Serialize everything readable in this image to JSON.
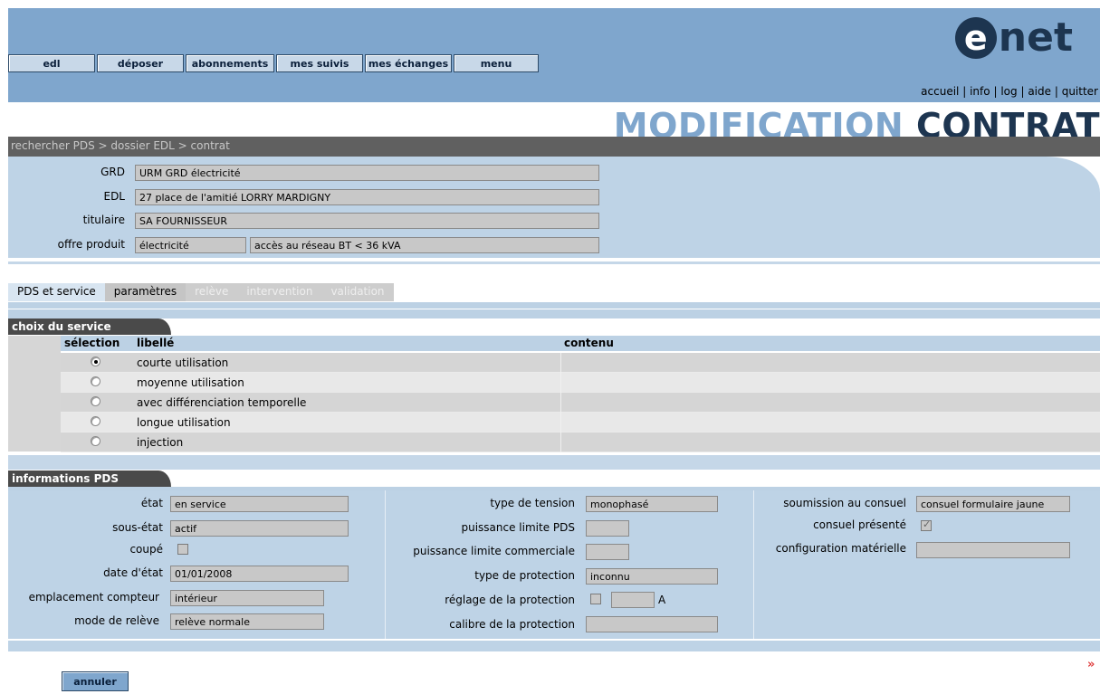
{
  "nav": {
    "edl": "edl",
    "deposer": "déposer",
    "abonnements": "abonnements",
    "mes_suivis": "mes suivis",
    "mes_echanges": "mes échanges",
    "menu": "menu"
  },
  "logo": {
    "e": "e",
    "text": "net"
  },
  "toplinks": {
    "accueil": "accueil",
    "info": "info",
    "log": "log",
    "aide": "aide",
    "quitter": "quitter",
    "sep": "|"
  },
  "page_title": {
    "part1": "MODIFICATION",
    "part2": "CONTRAT"
  },
  "breadcrumb": "rechercher PDS > dossier EDL > contrat",
  "context": {
    "grd_label": "GRD",
    "grd_value": "URM GRD électricité",
    "edl_label": "EDL",
    "edl_value": "27 place de l'amitié LORRY MARDIGNY",
    "titulaire_label": "titulaire",
    "titulaire_value": "SA FOURNISSEUR",
    "offre_label": "offre produit",
    "offre_value1": "électricité",
    "offre_value2": "accès au réseau BT < 36 kVA"
  },
  "tabs": [
    "PDS et service",
    "paramètres",
    "relève",
    "intervention",
    "validation"
  ],
  "choix_service": {
    "title": "choix du service",
    "col_selection": "sélection",
    "col_libelle": "libellé",
    "col_contenu": "contenu",
    "rows": [
      {
        "label": "courte utilisation",
        "selected": true
      },
      {
        "label": "moyenne utilisation",
        "selected": false
      },
      {
        "label": "avec différenciation temporelle",
        "selected": false
      },
      {
        "label": "longue utilisation",
        "selected": false
      },
      {
        "label": "injection",
        "selected": false
      }
    ]
  },
  "info_pds": {
    "title": "informations PDS",
    "etat_label": "état",
    "etat_value": "en service",
    "sous_etat_label": "sous-état",
    "sous_etat_value": "actif",
    "coupe_label": "coupé",
    "date_etat_label": "date d'état",
    "date_etat_value": "01/01/2008",
    "emplacement_label": "emplacement compteur",
    "emplacement_value": "intérieur",
    "mode_releve_label": "mode de relève",
    "mode_releve_value": "relève normale",
    "type_tension_label": "type de tension",
    "type_tension_value": "monophasé",
    "puissance_pds_label": "puissance limite PDS",
    "puissance_pds_value": "",
    "puissance_comm_label": "puissance limite commerciale",
    "puissance_comm_value": "",
    "type_protection_label": "type de protection",
    "type_protection_value": "inconnu",
    "reglage_label": "réglage de la protection",
    "reglage_value": "",
    "reglage_unit": "A",
    "calibre_label": "calibre de la protection",
    "calibre_value": "",
    "soumission_label": "soumission au consuel",
    "soumission_value": "consuel formulaire jaune",
    "consuel_presente_label": "consuel présenté",
    "consuel_presente_checked": true,
    "config_label": "configuration matérielle",
    "config_value": ""
  },
  "buttons": {
    "annuler": "annuler",
    "next": "»"
  }
}
